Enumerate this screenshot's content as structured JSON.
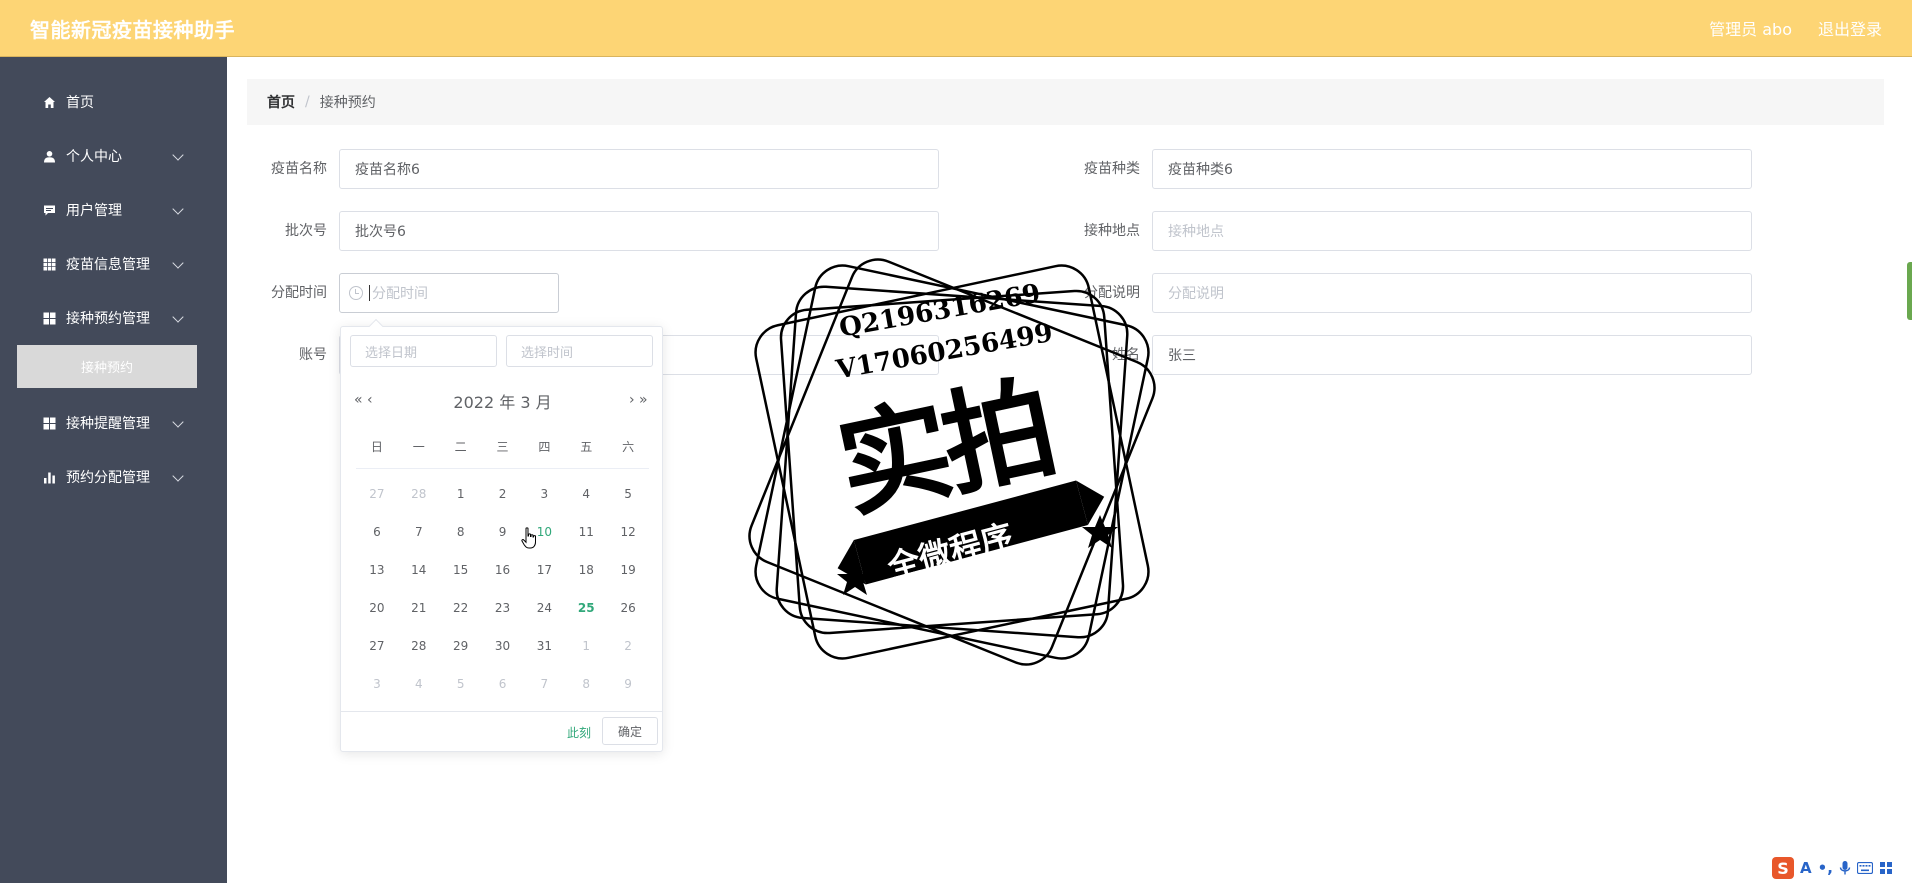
{
  "header": {
    "title": "智能新冠疫苗接种助手",
    "user_label": "管理员 abo",
    "logout_label": "退出登录"
  },
  "sidebar": {
    "items": [
      {
        "label": "首页",
        "icon": "home-icon"
      },
      {
        "label": "个人中心",
        "icon": "user-icon"
      },
      {
        "label": "用户管理",
        "icon": "comment-icon"
      },
      {
        "label": "疫苗信息管理",
        "icon": "grid-icon"
      },
      {
        "label": "接种预约管理",
        "icon": "apps-icon"
      },
      {
        "label": "接种提醒管理",
        "icon": "apps-icon"
      },
      {
        "label": "预约分配管理",
        "icon": "bar-chart-icon"
      }
    ],
    "active_sub": "接种预约"
  },
  "breadcrumb": {
    "home": "首页",
    "separator": "/",
    "current": "接种预约"
  },
  "form": {
    "vaccine_name_label": "疫苗名称",
    "vaccine_name_value": "疫苗名称6",
    "vaccine_type_label": "疫苗种类",
    "vaccine_type_value": "疫苗种类6",
    "batch_label": "批次号",
    "batch_value": "批次号6",
    "site_label": "接种地点",
    "site_placeholder": "接种地点",
    "assign_time_label": "分配时间",
    "assign_time_placeholder": "分配时间",
    "assign_note_label": "分配说明",
    "assign_note_placeholder": "分配说明",
    "account_label": "账号",
    "name_label": "姓名",
    "name_value": "张三"
  },
  "picker": {
    "date_placeholder": "选择日期",
    "time_placeholder": "选择时间",
    "prev_year": "«",
    "prev_month": "‹",
    "next_month": "›",
    "next_year": "»",
    "year_label": "2022 年",
    "month_label": "3 月",
    "weekdays": [
      "日",
      "一",
      "二",
      "三",
      "四",
      "五",
      "六"
    ],
    "weeks": [
      [
        "27",
        "28",
        "1",
        "2",
        "3",
        "4",
        "5"
      ],
      [
        "6",
        "7",
        "8",
        "9",
        "10",
        "11",
        "12"
      ],
      [
        "13",
        "14",
        "15",
        "16",
        "17",
        "18",
        "19"
      ],
      [
        "20",
        "21",
        "22",
        "23",
        "24",
        "25",
        "26"
      ],
      [
        "27",
        "28",
        "29",
        "30",
        "31",
        "1",
        "2"
      ],
      [
        "3",
        "4",
        "5",
        "6",
        "7",
        "8",
        "9"
      ]
    ],
    "today": "25",
    "hovered": "10",
    "now_label": "此刻",
    "ok_label": "确定"
  },
  "watermark": {
    "line1": "Q2196316269",
    "line2": "V17060256499",
    "big": "实拍",
    "ribbon": "全微程序"
  },
  "ime": {
    "logo": "S",
    "mode": "A",
    "punct": "•,"
  },
  "colors": {
    "header_bg": "#fdd575",
    "sidebar_bg": "#434a5a",
    "accent": "#31a87a"
  }
}
